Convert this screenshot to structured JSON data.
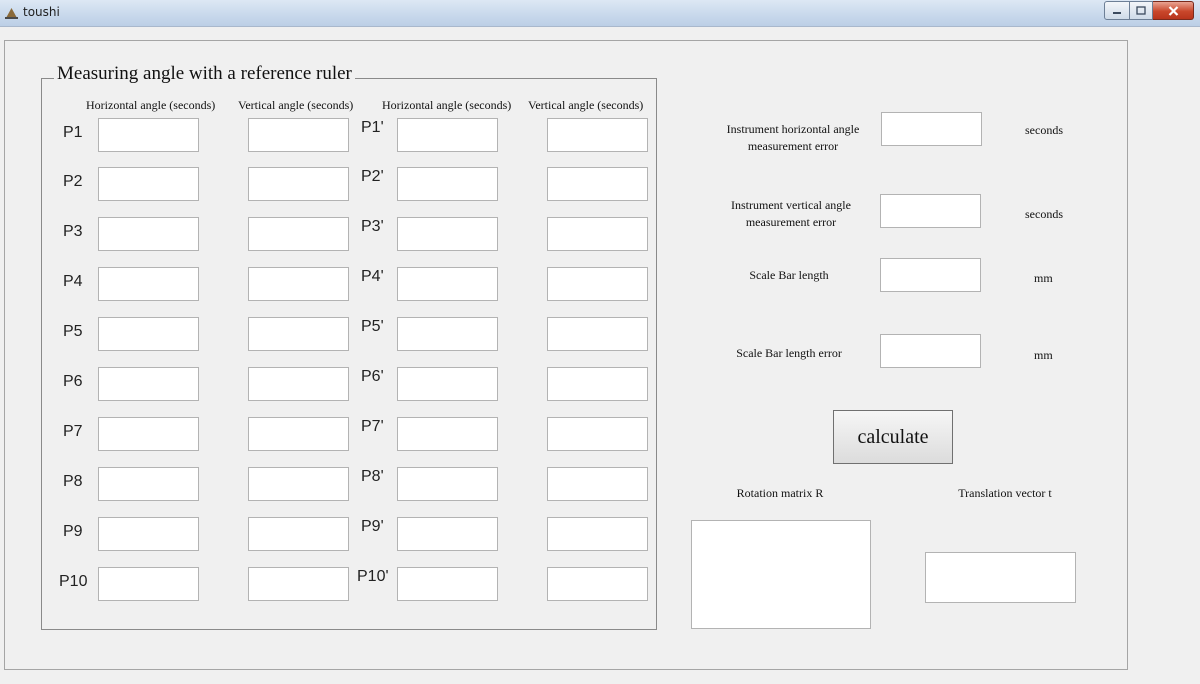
{
  "window": {
    "title": "toushi",
    "controls": [
      "minimize-icon",
      "maximize-icon",
      "close-icon"
    ]
  },
  "group": {
    "title": "Measuring angle with a reference ruler",
    "headers": [
      "Horizontal angle (seconds)",
      "Vertical angle (seconds)",
      "Horizontal angle (seconds)",
      "Vertical angle (seconds)"
    ],
    "points": [
      "P1",
      "P2",
      "P3",
      "P4",
      "P5",
      "P6",
      "P7",
      "P8",
      "P9",
      "P10"
    ],
    "points_prime": [
      "P1'",
      "P2'",
      "P3'",
      "P4'",
      "P5'",
      "P6'",
      "P7'",
      "P8'",
      "P9'",
      "P10'"
    ]
  },
  "params": {
    "h_error_label_1": "Instrument horizontal angle",
    "h_error_label_2": "measurement error",
    "h_error_unit": "seconds",
    "v_error_label_1": "Instrument vertical angle",
    "v_error_label_2": "measurement error",
    "v_error_unit": "seconds",
    "bar_length_label": "Scale Bar length",
    "bar_length_unit": "mm",
    "bar_error_label": "Scale Bar length error",
    "bar_error_unit": "mm"
  },
  "actions": {
    "calculate_label": "calculate"
  },
  "output": {
    "rotation_label": "Rotation matrix R",
    "translation_label": "Translation vector t"
  }
}
